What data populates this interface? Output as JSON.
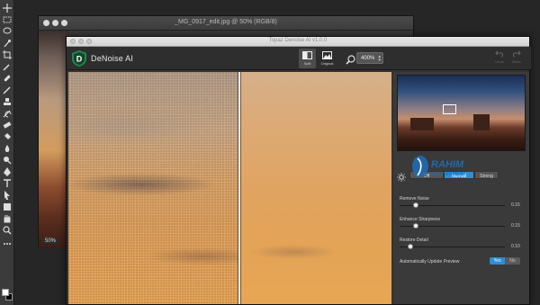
{
  "photoshop": {
    "doc_title": "_MG_0917_edit.jpg @ 50% (RGB/8)",
    "zoom": "50%"
  },
  "denoise": {
    "window_title": "Topaz Denoise AI v1.0.0",
    "app_name": "DeNoise AI",
    "view_split_label": "Split",
    "view_original_label": "Original",
    "zoom_value": "400%",
    "undo_label": "Undo",
    "redo_label": "Redo",
    "modes": [
      "Off",
      "Normal",
      "Strong"
    ],
    "active_mode": "Normal",
    "controls": [
      {
        "label": "Remove Noise",
        "value": "0.15",
        "level": 0.15
      },
      {
        "label": "Enhance Sharpness",
        "value": "0.15",
        "level": 0.15
      },
      {
        "label": "Restore Detail",
        "value": "0.10",
        "level": 0.1
      }
    ],
    "auto_update_label": "Automatically Update Preview",
    "auto_yes": "Yes",
    "auto_no": "No",
    "accent_color": "#2a8fd6"
  }
}
